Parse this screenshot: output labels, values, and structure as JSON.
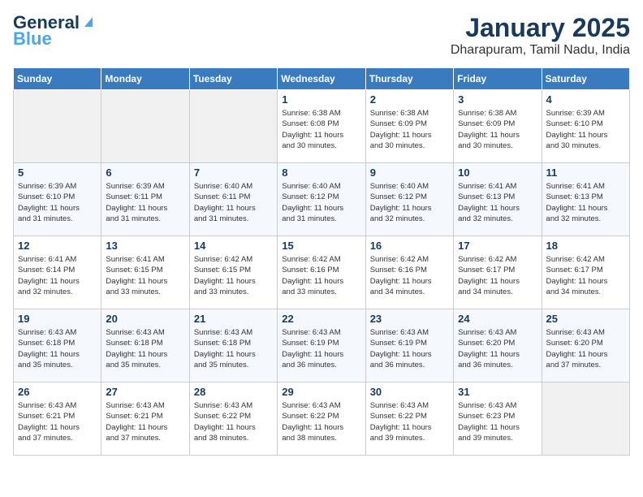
{
  "header": {
    "logo_line1": "General",
    "logo_line2": "Blue",
    "title": "January 2025",
    "subtitle": "Dharapuram, Tamil Nadu, India"
  },
  "days_of_week": [
    "Sunday",
    "Monday",
    "Tuesday",
    "Wednesday",
    "Thursday",
    "Friday",
    "Saturday"
  ],
  "weeks": [
    [
      {
        "day": "",
        "info": ""
      },
      {
        "day": "",
        "info": ""
      },
      {
        "day": "",
        "info": ""
      },
      {
        "day": "1",
        "info": "Sunrise: 6:38 AM\nSunset: 6:08 PM\nDaylight: 11 hours\nand 30 minutes."
      },
      {
        "day": "2",
        "info": "Sunrise: 6:38 AM\nSunset: 6:09 PM\nDaylight: 11 hours\nand 30 minutes."
      },
      {
        "day": "3",
        "info": "Sunrise: 6:38 AM\nSunset: 6:09 PM\nDaylight: 11 hours\nand 30 minutes."
      },
      {
        "day": "4",
        "info": "Sunrise: 6:39 AM\nSunset: 6:10 PM\nDaylight: 11 hours\nand 30 minutes."
      }
    ],
    [
      {
        "day": "5",
        "info": "Sunrise: 6:39 AM\nSunset: 6:10 PM\nDaylight: 11 hours\nand 31 minutes."
      },
      {
        "day": "6",
        "info": "Sunrise: 6:39 AM\nSunset: 6:11 PM\nDaylight: 11 hours\nand 31 minutes."
      },
      {
        "day": "7",
        "info": "Sunrise: 6:40 AM\nSunset: 6:11 PM\nDaylight: 11 hours\nand 31 minutes."
      },
      {
        "day": "8",
        "info": "Sunrise: 6:40 AM\nSunset: 6:12 PM\nDaylight: 11 hours\nand 31 minutes."
      },
      {
        "day": "9",
        "info": "Sunrise: 6:40 AM\nSunset: 6:12 PM\nDaylight: 11 hours\nand 32 minutes."
      },
      {
        "day": "10",
        "info": "Sunrise: 6:41 AM\nSunset: 6:13 PM\nDaylight: 11 hours\nand 32 minutes."
      },
      {
        "day": "11",
        "info": "Sunrise: 6:41 AM\nSunset: 6:13 PM\nDaylight: 11 hours\nand 32 minutes."
      }
    ],
    [
      {
        "day": "12",
        "info": "Sunrise: 6:41 AM\nSunset: 6:14 PM\nDaylight: 11 hours\nand 32 minutes."
      },
      {
        "day": "13",
        "info": "Sunrise: 6:41 AM\nSunset: 6:15 PM\nDaylight: 11 hours\nand 33 minutes."
      },
      {
        "day": "14",
        "info": "Sunrise: 6:42 AM\nSunset: 6:15 PM\nDaylight: 11 hours\nand 33 minutes."
      },
      {
        "day": "15",
        "info": "Sunrise: 6:42 AM\nSunset: 6:16 PM\nDaylight: 11 hours\nand 33 minutes."
      },
      {
        "day": "16",
        "info": "Sunrise: 6:42 AM\nSunset: 6:16 PM\nDaylight: 11 hours\nand 34 minutes."
      },
      {
        "day": "17",
        "info": "Sunrise: 6:42 AM\nSunset: 6:17 PM\nDaylight: 11 hours\nand 34 minutes."
      },
      {
        "day": "18",
        "info": "Sunrise: 6:42 AM\nSunset: 6:17 PM\nDaylight: 11 hours\nand 34 minutes."
      }
    ],
    [
      {
        "day": "19",
        "info": "Sunrise: 6:43 AM\nSunset: 6:18 PM\nDaylight: 11 hours\nand 35 minutes."
      },
      {
        "day": "20",
        "info": "Sunrise: 6:43 AM\nSunset: 6:18 PM\nDaylight: 11 hours\nand 35 minutes."
      },
      {
        "day": "21",
        "info": "Sunrise: 6:43 AM\nSunset: 6:18 PM\nDaylight: 11 hours\nand 35 minutes."
      },
      {
        "day": "22",
        "info": "Sunrise: 6:43 AM\nSunset: 6:19 PM\nDaylight: 11 hours\nand 36 minutes."
      },
      {
        "day": "23",
        "info": "Sunrise: 6:43 AM\nSunset: 6:19 PM\nDaylight: 11 hours\nand 36 minutes."
      },
      {
        "day": "24",
        "info": "Sunrise: 6:43 AM\nSunset: 6:20 PM\nDaylight: 11 hours\nand 36 minutes."
      },
      {
        "day": "25",
        "info": "Sunrise: 6:43 AM\nSunset: 6:20 PM\nDaylight: 11 hours\nand 37 minutes."
      }
    ],
    [
      {
        "day": "26",
        "info": "Sunrise: 6:43 AM\nSunset: 6:21 PM\nDaylight: 11 hours\nand 37 minutes."
      },
      {
        "day": "27",
        "info": "Sunrise: 6:43 AM\nSunset: 6:21 PM\nDaylight: 11 hours\nand 37 minutes."
      },
      {
        "day": "28",
        "info": "Sunrise: 6:43 AM\nSunset: 6:22 PM\nDaylight: 11 hours\nand 38 minutes."
      },
      {
        "day": "29",
        "info": "Sunrise: 6:43 AM\nSunset: 6:22 PM\nDaylight: 11 hours\nand 38 minutes."
      },
      {
        "day": "30",
        "info": "Sunrise: 6:43 AM\nSunset: 6:22 PM\nDaylight: 11 hours\nand 39 minutes."
      },
      {
        "day": "31",
        "info": "Sunrise: 6:43 AM\nSunset: 6:23 PM\nDaylight: 11 hours\nand 39 minutes."
      },
      {
        "day": "",
        "info": ""
      }
    ]
  ]
}
